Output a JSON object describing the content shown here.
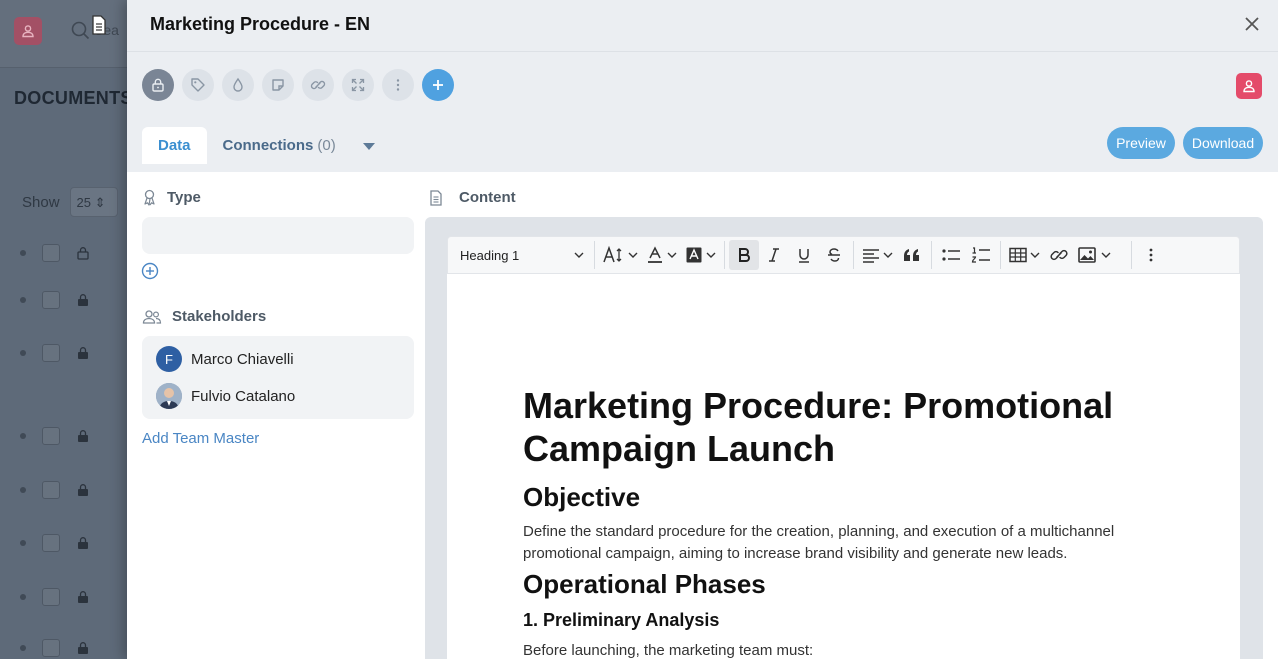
{
  "background": {
    "search_placeholder": "Sea",
    "title": "DOCUMENTS",
    "show_label": "Show",
    "page_size": "25"
  },
  "modal": {
    "title": "Marketing Procedure - EN",
    "toolbar_icons": [
      "lock-icon",
      "tag-icon",
      "drop-icon",
      "note-icon",
      "link-icon",
      "expand-icon",
      "more-vertical-icon",
      "plus-icon"
    ],
    "tabs": {
      "data": "Data",
      "connections": "Connections",
      "connections_count": "(0)"
    },
    "preview_label": "Preview",
    "download_label": "Download",
    "accent": "#5ba9e0",
    "user_chip_color": "#e44b6a"
  },
  "left": {
    "type_label": "Type",
    "stakeholders_label": "Stakeholders",
    "stakeholders": [
      {
        "name": "Marco Chiavelli",
        "initial": "F"
      },
      {
        "name": "Fulvio Catalano",
        "initial": ""
      }
    ],
    "add_team_master": "Add Team Master"
  },
  "content": {
    "label": "Content",
    "editor": {
      "heading_select": "Heading 1"
    },
    "doc": {
      "h1": "Marketing Procedure: Promotional Campaign Launch",
      "h2_objective": "Objective",
      "p_objective": "Define the standard procedure for the creation, planning, and execution of a multichannel promotional campaign, aiming to increase brand visibility and generate new leads.",
      "h2_phases": "Operational Phases",
      "h3_analysis": "1. Preliminary Analysis",
      "p_analysis": "Before launching, the marketing team must:"
    }
  }
}
